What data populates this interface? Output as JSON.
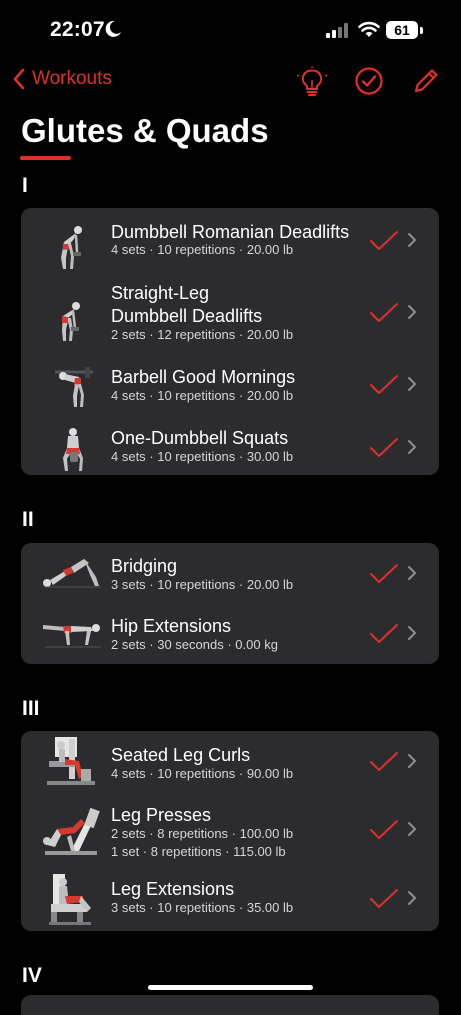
{
  "status": {
    "time": "22:07",
    "battery": "61"
  },
  "nav": {
    "back_label": "Workouts"
  },
  "page": {
    "title": "Glutes & Quads"
  },
  "sections": [
    {
      "label": "I",
      "exercises": [
        {
          "name": "Dumbbell Romanian Deadlifts",
          "details": [
            "4 sets · 10 repetitions · 20.00 lb"
          ]
        },
        {
          "name": "Straight-Leg",
          "name2": "Dumbbell Deadlifts",
          "details": [
            "2 sets · 12 repetitions · 20.00 lb"
          ]
        },
        {
          "name": "Barbell Good Mornings",
          "details": [
            "4 sets · 10 repetitions · 20.00 lb"
          ]
        },
        {
          "name": "One-Dumbbell Squats",
          "details": [
            "4 sets · 10 repetitions · 30.00 lb"
          ]
        }
      ]
    },
    {
      "label": "II",
      "exercises": [
        {
          "name": "Bridging",
          "details": [
            "3 sets · 10 repetitions · 20.00 lb"
          ]
        },
        {
          "name": "Hip Extensions",
          "details": [
            "2 sets · 30 seconds · 0.00 kg"
          ]
        }
      ]
    },
    {
      "label": "III",
      "exercises": [
        {
          "name": "Seated Leg Curls",
          "details": [
            "4 sets · 10 repetitions · 90.00 lb"
          ]
        },
        {
          "name": "Leg Presses",
          "details": [
            "2 sets · 8 repetitions · 100.00 lb",
            "1 set · 8 repetitions · 115.00 lb"
          ]
        },
        {
          "name": "Leg Extensions",
          "details": [
            "3 sets · 10 repetitions · 35.00 lb"
          ]
        }
      ]
    },
    {
      "label": "IV",
      "exercises": []
    }
  ],
  "icons": {
    "back": "chevron-left-icon",
    "tips": "lightbulb-icon",
    "complete": "checkmark-circle-icon",
    "edit": "pencil-icon",
    "done": "checkmark-icon",
    "disclosure": "chevron-right-icon"
  },
  "colors": {
    "accent": "#e0302a",
    "background": "#000000",
    "card": "#2c2c2e",
    "text": "#ffffff",
    "secondary_text": "#d6d6d6"
  }
}
